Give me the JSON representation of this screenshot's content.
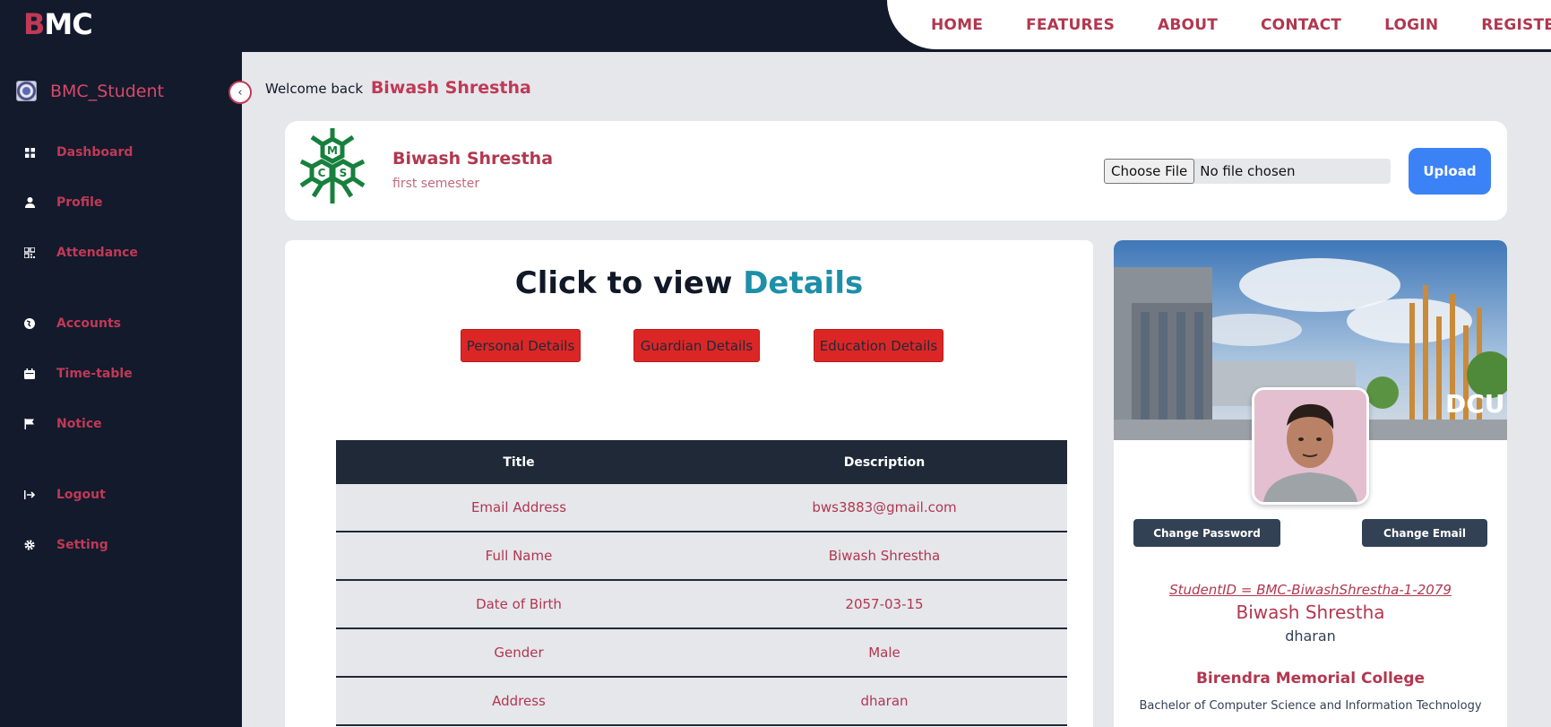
{
  "brand": {
    "logo_b": "B",
    "logo_mc": "MC"
  },
  "nav": {
    "items": [
      "HOME",
      "FEATURES",
      "ABOUT",
      "CONTACT",
      "LOGIN",
      "REGISTER"
    ]
  },
  "sidebar": {
    "username": "BMC_Student",
    "items": [
      {
        "label": "Dashboard",
        "icon": "grid-icon"
      },
      {
        "label": "Profile",
        "icon": "user-icon"
      },
      {
        "label": "Attendance",
        "icon": "qr-icon"
      },
      {
        "label": "Accounts",
        "icon": "globe-icon"
      },
      {
        "label": "Time-table",
        "icon": "calendar-icon"
      },
      {
        "label": "Notice",
        "icon": "flag-icon"
      },
      {
        "label": "Logout",
        "icon": "logout-icon"
      },
      {
        "label": "Setting",
        "icon": "gear-icon"
      }
    ]
  },
  "welcome": {
    "prefix": "Welcome back",
    "name": "Biwash Shrestha"
  },
  "profile": {
    "name": "Biwash Shrestha",
    "semester": "first semester",
    "logo_letters": [
      "M",
      "C",
      "S"
    ],
    "file_button": "Choose File",
    "file_status": "No file chosen",
    "upload_label": "Upload"
  },
  "details": {
    "title_prefix": "Click to view",
    "title_highlight": "Details",
    "tabs": [
      "Personal Details",
      "Guardian Details",
      "Education Details"
    ],
    "columns": [
      "Title",
      "Description"
    ],
    "rows": [
      [
        "Email Address",
        "bws3883@gmail.com"
      ],
      [
        "Full Name",
        "Biwash Shrestha"
      ],
      [
        "Date of Birth",
        "2057-03-15"
      ],
      [
        "Gender",
        "Male"
      ],
      [
        "Address",
        "dharan"
      ]
    ]
  },
  "card": {
    "banner_text": "DCU",
    "change_password": "Change Password",
    "change_email": "Change Email",
    "student_id": "StudentID = BMC-BiwashShrestha-1-2079",
    "name": "Biwash Shrestha",
    "city": "dharan",
    "college": "Birendra Memorial College",
    "program": "Bachelor of Computer Science and Information Technology"
  },
  "colors": {
    "accent": "#c03956",
    "dark": "#121a2c",
    "upload": "#3b82f6",
    "tab": "#dc2626",
    "highlight": "#1d8fa8"
  }
}
